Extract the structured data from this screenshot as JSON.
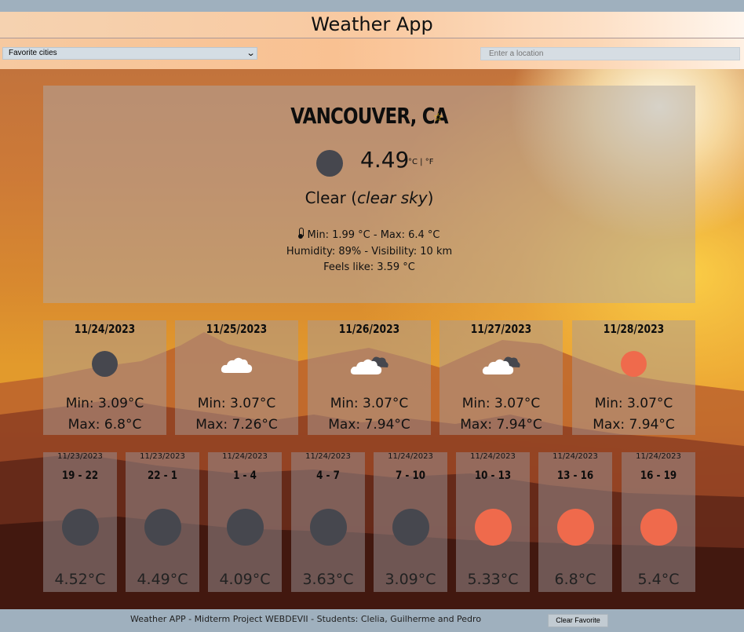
{
  "header": {
    "title": "Weather App"
  },
  "controls": {
    "favorites_select": "Favorite cities",
    "location_placeholder": "Enter a location"
  },
  "current": {
    "city": "VANCOUVER, CA",
    "favorite_icon": "star-icon",
    "condition_icon": "moon-icon",
    "temperature": "4.49",
    "units": "°C | °F",
    "condition": "Clear",
    "condition_detail": "clear sky",
    "thermometer_icon": "thermometer-icon",
    "minmax": "Min: 1.99 °C - Max: 6.4 °C",
    "humidity_visibility": "Humidity: 89% - Visibility: 10 km",
    "feels_like": "Feels like: 3.59 °C"
  },
  "daily": [
    {
      "date": "11/24/2023",
      "icon": "moon-icon",
      "min": "Min: 3.09°C",
      "max": "Max: 6.8°C"
    },
    {
      "date": "11/25/2023",
      "icon": "cloud-icon",
      "min": "Min: 3.07°C",
      "max": "Max: 7.26°C"
    },
    {
      "date": "11/26/2023",
      "icon": "clouds-icon",
      "min": "Min: 3.07°C",
      "max": "Max: 7.94°C"
    },
    {
      "date": "11/27/2023",
      "icon": "clouds-icon",
      "min": "Min: 3.07°C",
      "max": "Max: 7.94°C"
    },
    {
      "date": "11/28/2023",
      "icon": "sun-icon",
      "min": "Min: 3.07°C",
      "max": "Max: 7.94°C"
    }
  ],
  "hourly": [
    {
      "date": "11/23/2023",
      "range": "19 - 22",
      "icon": "moon-icon",
      "temp": "4.52°C"
    },
    {
      "date": "11/23/2023",
      "range": "22 - 1",
      "icon": "moon-icon",
      "temp": "4.49°C"
    },
    {
      "date": "11/24/2023",
      "range": "1 - 4",
      "icon": "moon-icon",
      "temp": "4.09°C"
    },
    {
      "date": "11/24/2023",
      "range": "4 - 7",
      "icon": "moon-icon",
      "temp": "3.63°C"
    },
    {
      "date": "11/24/2023",
      "range": "7 - 10",
      "icon": "moon-icon",
      "temp": "3.09°C"
    },
    {
      "date": "11/24/2023",
      "range": "10 - 13",
      "icon": "sun-icon",
      "temp": "5.33°C"
    },
    {
      "date": "11/24/2023",
      "range": "13 - 16",
      "icon": "sun-icon",
      "temp": "6.8°C"
    },
    {
      "date": "11/24/2023",
      "range": "16 - 19",
      "icon": "sun-icon",
      "temp": "5.4°C"
    }
  ],
  "footer": {
    "text": "Weather APP - Midterm Project WEBDEVII - Students: Clelia, Guilherme and Pedro",
    "clear_button": "Clear Favorite"
  },
  "colors": {
    "sun": "#ef6a4c",
    "moon": "#46474e",
    "star": "#f1c40f"
  }
}
